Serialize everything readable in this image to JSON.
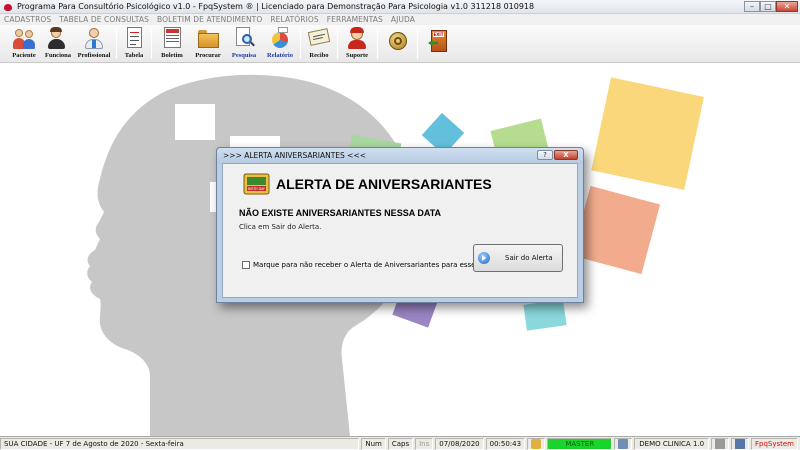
{
  "window": {
    "title": "Programa Para Consultório Psicológico v1.0 - FpqSystem ® | Licenciado para  Demonstração Para Psicologia v1.0 311218 010918"
  },
  "menu": [
    "CADASTROS",
    "TABELA DE CONSULTAS",
    "BOLETIM DE ATENDIMENTO",
    "RELATÓRIOS",
    "FERRAMENTAS",
    "AJUDA"
  ],
  "toolbar": {
    "paciente": "Paciente",
    "funciona": "Funciona",
    "profissional": "Profissional",
    "tabela": "Tabela",
    "boletim": "Boletim",
    "procurar": "Procurar",
    "pesquisa": "Pesquisa",
    "relatorio": "Relatório",
    "recibo": "Recibo",
    "suporte": "Suporte",
    "exit_label": "EXIT"
  },
  "dialog": {
    "title": ">>> ALERTA ANIVERSARIANTES <<<",
    "help": "?",
    "close": "X",
    "heading": "ALERTA DE ANIVERSARIANTES",
    "message": "NÃO EXISTE ANIVERSARIANTES NESSA DATA",
    "hint": "Clica em Sair do Alerta.",
    "checkbox_label": "Marque para não receber o Alerta de Aniversariantes para esse dia",
    "button_label": "Sair do Alerta",
    "icon_label": "BIRTH DAY"
  },
  "status": {
    "city": "SUA CIDADE - UF  7 de Agosto de 2020 - Sexta-feira",
    "num": "Num",
    "caps": "Caps",
    "ins": "Ins",
    "date": "07/08/2020",
    "time": "00:50:43",
    "master": "MASTER",
    "demo": "DEMO CLINICA 1.0",
    "brand": "FpqSystem"
  },
  "colors": {
    "master_green": "#19d42a",
    "brand_red": "#d01010",
    "square_yellow": "#f9d77a",
    "square_green": "#b6dc8f",
    "square_blue": "#63c0dc",
    "square_orange": "#f2ab8d",
    "square_purple": "#9b85c2",
    "square_teal": "#8ad8dc"
  }
}
